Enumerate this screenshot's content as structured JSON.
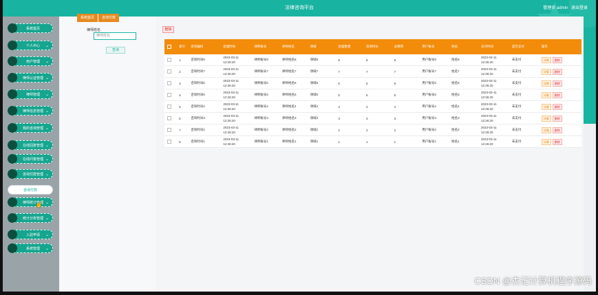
{
  "header": {
    "title": "法律咨询平台",
    "user_label": "管理员 admin",
    "logout": "退出登录"
  },
  "sidebar": {
    "items": [
      {
        "label": "系统首页",
        "arrow": false
      },
      {
        "label": "个人中心",
        "arrow": true
      },
      {
        "label": "用户管理",
        "arrow": true
      },
      {
        "label": "律师认证管理",
        "arrow": true
      },
      {
        "label": "律师管理",
        "arrow": true
      },
      {
        "label": "律师信息管理",
        "arrow": true
      },
      {
        "label": "我的咨询管理",
        "arrow": true
      },
      {
        "label": "在线回复管理",
        "arrow": true
      },
      {
        "label": "在线问答管理",
        "arrow": true
      },
      {
        "label": "咨询付款管理",
        "arrow": true
      },
      {
        "label": "咨询付款",
        "arrow": false,
        "active": true
      },
      {
        "label": "律师统计管理",
        "arrow": true
      },
      {
        "label": "统计分析管理",
        "arrow": true
      },
      {
        "label": "入驻申请",
        "arrow": true
      },
      {
        "label": "系统管理",
        "arrow": true
      }
    ]
  },
  "breadcrumb": {
    "home": "系统首页",
    "current": "咨询付款"
  },
  "search": {
    "label": "律师姓名",
    "placeholder": "律师姓名",
    "button": "查询"
  },
  "toolbar": {
    "delete": "删除"
  },
  "table": {
    "headers": [
      "",
      "索引",
      "咨询编码",
      "处理时间",
      "律师账号",
      "律师姓名",
      "领域",
      "处理数量",
      "咨询时长",
      "总费用",
      "用户账号",
      "姓名",
      "支付时间",
      "是否支付",
      "操作"
    ],
    "rows": [
      [
        "",
        "1",
        "咨询时间8",
        "2023-03-11 12:26:20",
        "律师账号8",
        "律师姓名8",
        "领域8",
        "8",
        "8",
        "8",
        "用户账号8",
        "姓名8",
        "2023-03-11 12:26:20",
        "未支付"
      ],
      [
        "",
        "2",
        "咨询时间7",
        "2023-03-11 12:26:20",
        "律师账号7",
        "律师姓名7",
        "领域7",
        "7",
        "7",
        "7",
        "用户账号7",
        "姓名7",
        "2023-03-11 12:26:20",
        "未支付"
      ],
      [
        "",
        "3",
        "咨询时间6",
        "2023-03-11 12:26:20",
        "律师账号6",
        "律师姓名6",
        "领域6",
        "6",
        "6",
        "6",
        "用户账号6",
        "姓名6",
        "2023-03-11 12:26:20",
        "未支付"
      ],
      [
        "",
        "4",
        "咨询时间5",
        "2023-03-11 12:26:20",
        "律师账号5",
        "律师姓名5",
        "领域5",
        "5",
        "5",
        "5",
        "用户账号5",
        "姓名5",
        "2023-03-11 12:26:20",
        "未支付"
      ],
      [
        "",
        "5",
        "咨询时间4",
        "2023-03-11 12:26:20",
        "律师账号4",
        "律师姓名4",
        "领域4",
        "4",
        "4",
        "4",
        "用户账号4",
        "姓名4",
        "2023-03-11 12:26:20",
        "未支付"
      ],
      [
        "",
        "6",
        "咨询时间3",
        "2023-03-11 12:26:20",
        "律师账号3",
        "律师姓名3",
        "领域3",
        "3",
        "3",
        "3",
        "用户账号3",
        "姓名3",
        "2023-03-11 12:26:20",
        "未支付"
      ],
      [
        "",
        "7",
        "咨询时间2",
        "2023-03-11 12:26:20",
        "律师账号2",
        "律师姓名2",
        "领域2",
        "2",
        "2",
        "2",
        "用户账号2",
        "姓名2",
        "2023-03-11 12:26:20",
        "未支付"
      ],
      [
        "",
        "8",
        "咨询时间1",
        "2023-03-11 12:26:20",
        "律师账号1",
        "律师姓名1",
        "领域1",
        "1",
        "1",
        "1",
        "用户账号1",
        "姓名1",
        "2023-03-11 12:26:20",
        "未支付"
      ]
    ],
    "actions": {
      "detail": "详情",
      "delete": "删除"
    }
  },
  "watermark": "CSDN @杰记计算机程序源码",
  "colors": {
    "primary": "#19b3a1",
    "table_header": "#f28c0a",
    "danger": "#dd3333"
  }
}
